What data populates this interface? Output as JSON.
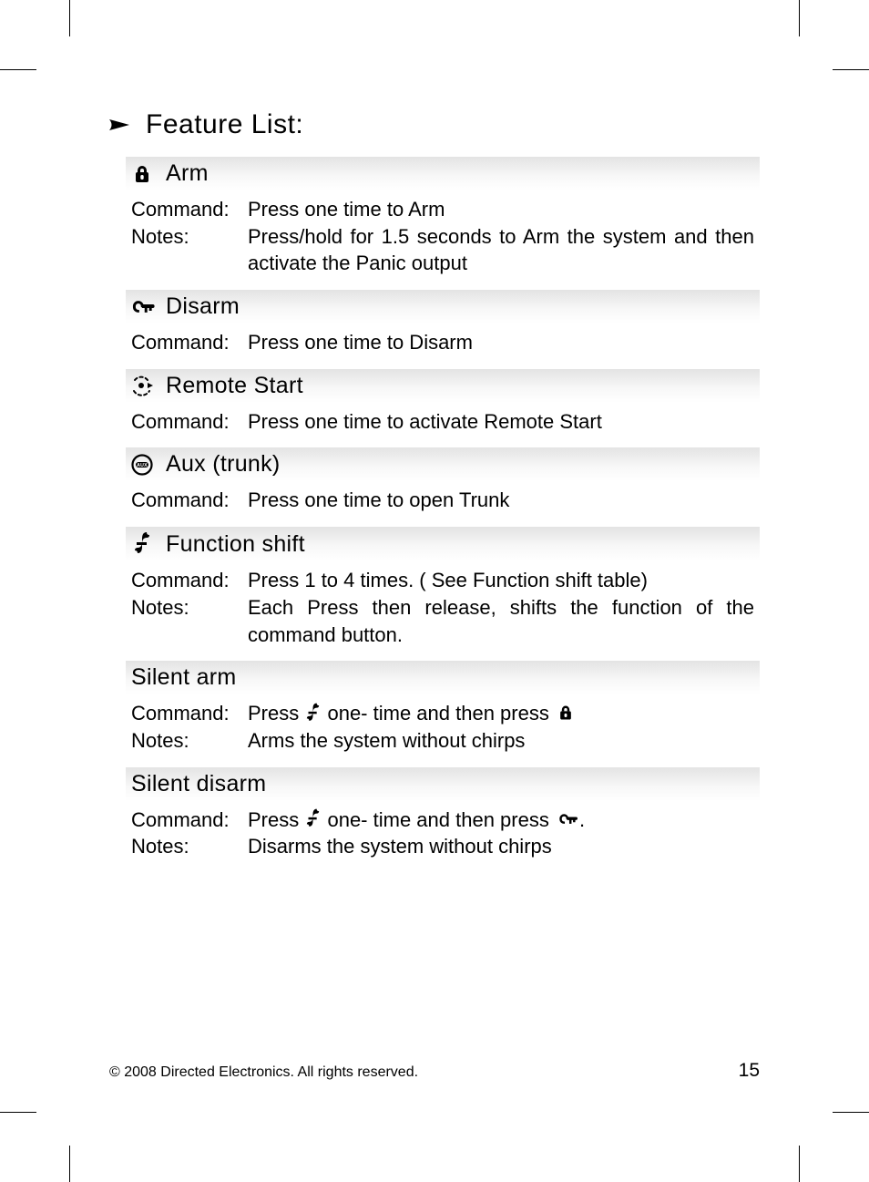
{
  "page_title": "Feature List:",
  "sections": [
    {
      "icon": "lock",
      "title": "Arm",
      "rows": [
        {
          "label": "Command",
          "value_parts": [
            [
              "text",
              "Press one time to Arm"
            ]
          ]
        },
        {
          "label": "Notes",
          "value_parts": [
            [
              "text",
              "Press/hold for 1.5 seconds to Arm the system and then activate the Panic output"
            ]
          ]
        }
      ]
    },
    {
      "icon": "unlock",
      "title": "Disarm",
      "rows": [
        {
          "label": "Command",
          "value_parts": [
            [
              "text",
              "Press one time to Disarm"
            ]
          ]
        }
      ]
    },
    {
      "icon": "remote-start",
      "title": "Remote Start",
      "rows": [
        {
          "label": "Command",
          "value_parts": [
            [
              "text",
              "Press one time to activate Remote Start"
            ]
          ]
        }
      ]
    },
    {
      "icon": "aux",
      "title": "Aux (trunk)",
      "rows": [
        {
          "label": "Command",
          "value_parts": [
            [
              "text",
              "Press one time to open Trunk"
            ]
          ]
        }
      ]
    },
    {
      "icon": "function",
      "title": "Function shift",
      "rows": [
        {
          "label": "Command",
          "value_parts": [
            [
              "text",
              "Press 1 to 4 times. ( See Function shift table)"
            ]
          ]
        },
        {
          "label": "Notes",
          "value_parts": [
            [
              "text",
              "Each Press then release, shifts the function of the command button."
            ]
          ]
        }
      ]
    },
    {
      "icon": null,
      "title": "Silent arm",
      "rows": [
        {
          "label": "Command",
          "value_parts": [
            [
              "text",
              "Press "
            ],
            [
              "icon",
              "function"
            ],
            [
              "text",
              " one- time and then press "
            ],
            [
              "icon",
              "lock"
            ]
          ]
        },
        {
          "label": "Notes",
          "value_parts": [
            [
              "text",
              "Arms the system without chirps"
            ]
          ]
        }
      ]
    },
    {
      "icon": null,
      "title": "Silent disarm",
      "rows": [
        {
          "label": "Command",
          "value_parts": [
            [
              "text",
              "Press "
            ],
            [
              "icon",
              "function"
            ],
            [
              "text",
              " one- time and then press  "
            ],
            [
              "icon",
              "unlock"
            ],
            [
              "text",
              "."
            ]
          ]
        },
        {
          "label": "Notes",
          "value_parts": [
            [
              "text",
              "Disarms the system without chirps"
            ]
          ]
        }
      ]
    }
  ],
  "footer": {
    "copyright": "© 2008 Directed Electronics. All rights reserved.",
    "page_number": "15"
  }
}
